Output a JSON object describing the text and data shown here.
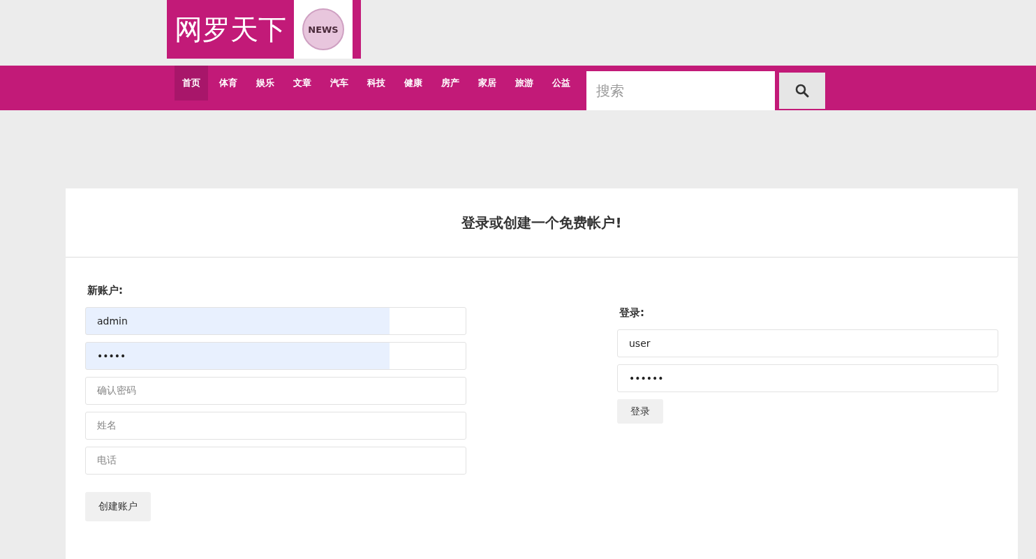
{
  "logo": {
    "title": "网罗天下",
    "badge": "NEWS"
  },
  "nav": [
    {
      "label": "首页",
      "selected": true
    },
    {
      "label": "体育",
      "selected": false
    },
    {
      "label": "娱乐",
      "selected": false
    },
    {
      "label": "文章",
      "selected": false
    },
    {
      "label": "汽车",
      "selected": false
    },
    {
      "label": "科技",
      "selected": false
    },
    {
      "label": "健康",
      "selected": false
    },
    {
      "label": "房产",
      "selected": false
    },
    {
      "label": "家居",
      "selected": false
    },
    {
      "label": "旅游",
      "selected": false
    },
    {
      "label": "公益",
      "selected": false
    }
  ],
  "search": {
    "placeholder": "搜索"
  },
  "card": {
    "title": "登录或创建一个免费帐户!"
  },
  "new_account": {
    "heading": "新账户:",
    "fields": [
      {
        "value": "admin",
        "autofilled": true
      },
      {
        "value": "•••••",
        "autofilled": true
      },
      {
        "placeholder": "确认密码",
        "autofilled": false
      },
      {
        "placeholder": "姓名",
        "autofilled": false
      },
      {
        "placeholder": "电话",
        "autofilled": false
      }
    ],
    "button": "创建账户"
  },
  "login": {
    "heading": "登录:",
    "fields": [
      {
        "value": "user",
        "autofilled": false
      },
      {
        "value": "••••••",
        "autofilled": false
      }
    ],
    "button": "登录"
  }
}
